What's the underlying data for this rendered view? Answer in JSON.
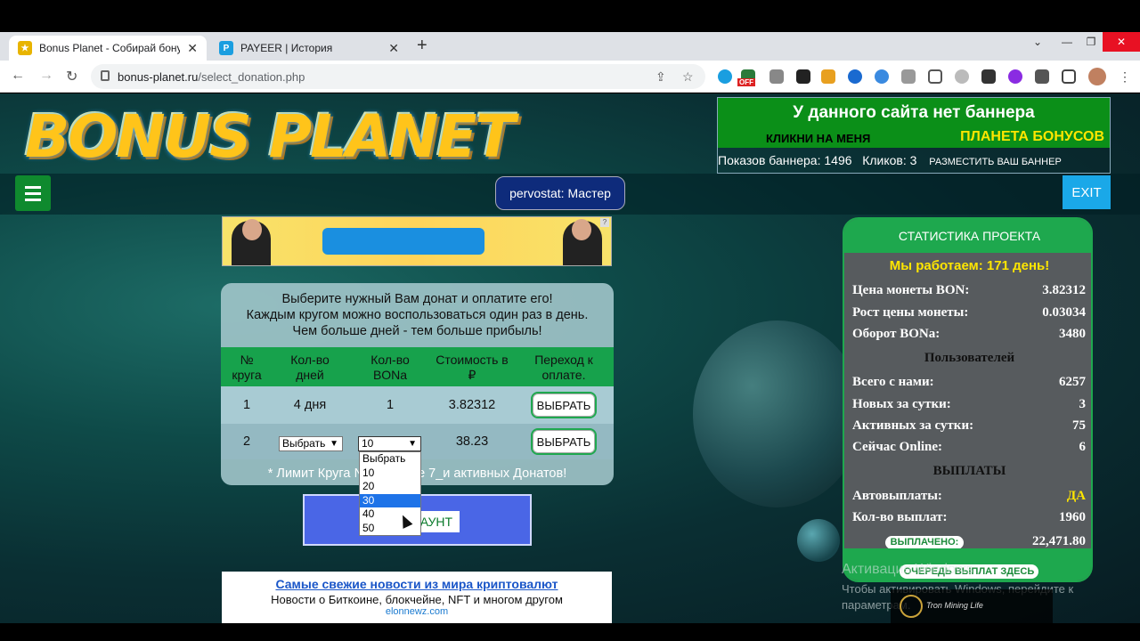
{
  "browser": {
    "tabs": [
      {
        "title": "Bonus Planet - Собирай бонусы",
        "active": true,
        "favicon": "bonus-planet-favicon"
      },
      {
        "title": "PAYEER | История",
        "active": false,
        "favicon": "payeer-favicon"
      }
    ],
    "new_tab": "+",
    "url_host": "bonus-planet.ru",
    "url_path": "/select_donation.php",
    "ext_badge": "OFF"
  },
  "header": {
    "logo_text": "BONUS PLANET",
    "banner": {
      "line1": "У данного сайта нет баннера",
      "line2": "КЛИКНИ НА МЕНЯ",
      "line3": "ПЛАНЕТА БОНУСОВ",
      "shows": "Показов баннера: 1496",
      "clicks": "Кликов: 3",
      "place": "РАЗМЕСТИТЬ ВАШ БАННЕР"
    },
    "user": "pervostat: Мастер",
    "exit_label": "EXIT"
  },
  "donation": {
    "intro1": "Выберите нужный Вам донат и оплатите его!",
    "intro2": "Каждым кругом можно воспользоваться один раз в день.",
    "intro3": "Чем больше дней - тем больше прибыль!",
    "columns": [
      {
        "l1": "№",
        "l2": "круга"
      },
      {
        "l1": "Кол-во",
        "l2": "дней"
      },
      {
        "l1": "Кол-во",
        "l2": "BONa"
      },
      {
        "l1": "Стоимость в",
        "l2": "₽"
      },
      {
        "l1": "Переход к",
        "l2": "оплате."
      }
    ],
    "rows": [
      {
        "num": "1",
        "days": "4 дня",
        "bon": "1",
        "cost": "3.82312",
        "button": "ВЫБРАТЬ"
      },
      {
        "num": "2",
        "days_select": "Выбрать",
        "bon_select": "10",
        "cost": "38.23",
        "button": "ВЫБРАТЬ"
      }
    ],
    "limit_left": "* Лимит Круга №",
    "limit_right": "ее 7_и активных Донатов!",
    "dropdown_options": [
      "Выбрать",
      "10",
      "20",
      "30",
      "40",
      "50"
    ],
    "dropdown_highlight": "30",
    "account_btn_visible": "АУНТ"
  },
  "news": {
    "headline": "Самые свежие новости из мира криптовалют",
    "sub": "Новости о Биткоине, блокчейне, NFT и многом другом",
    "url": "elonnewz.com"
  },
  "stats": {
    "title": "СТАТИСТИКА ПРОЕКТА",
    "working": "Мы работаем: 171 день!",
    "rows_top": [
      {
        "k": "Цена монеты BON:",
        "v": "3.82312"
      },
      {
        "k": "Рост цены монеты:",
        "v": "0.03034"
      },
      {
        "k": "Оборот BONа:",
        "v": "3480"
      }
    ],
    "users_title": "Пользователей",
    "rows_users": [
      {
        "k": "Всего с нами:",
        "v": "6257"
      },
      {
        "k": "Новых за сутки:",
        "v": "3"
      },
      {
        "k": "Активных за сутки:",
        "v": "75"
      },
      {
        "k": "Сейчас Online:",
        "v": "6"
      }
    ],
    "payouts_title": "ВЫПЛАТЫ",
    "auto_k": "Автовыплаты:",
    "auto_v": "ДА",
    "count_k": "Кол-во выплат:",
    "count_v": "1960",
    "paid_label": "ВЫПЛАЧЕНО:",
    "paid_v": "22,471.80",
    "queue_label": "ОЧЕРЕДЬ ВЫПЛАТ ЗДЕСЬ"
  },
  "windows": {
    "activate": "Активация Windows",
    "activate_sub1": "Чтобы активировать Windows, перейдите к",
    "activate_sub2": "параметрам."
  },
  "overlay_ad": "Tron Mining Life"
}
